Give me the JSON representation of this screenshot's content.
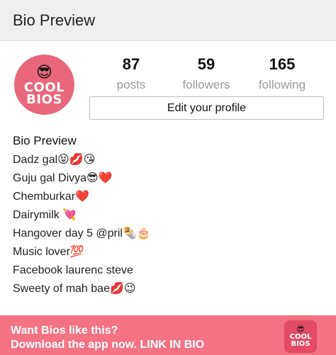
{
  "header": {
    "title": "Bio Preview"
  },
  "profile": {
    "avatar": {
      "emoji": "😎",
      "brand_line1": "COOL",
      "brand_line2": "BIOS"
    },
    "stats": [
      {
        "value": "87",
        "label": "posts"
      },
      {
        "value": "59",
        "label": "followers"
      },
      {
        "value": "165",
        "label": "following"
      }
    ],
    "edit_button": "Edit your profile"
  },
  "bio": {
    "name": "Bio Preview",
    "lines": [
      "Dadz gal😝💋😘",
      "Guju gal Divya😎❤️",
      "Chemburkar❤️",
      "Dairymilk 💘",
      "Hangover day 5 @pril🌯🎂",
      "Music lover💯",
      "Facebook laurenc steve",
      "Sweety of mah bae💋😉"
    ]
  },
  "banner": {
    "line1": "Want Bios like this?",
    "line2": "Download the app now. LINK IN BIO",
    "logo": {
      "emoji": "😎",
      "brand_line1": "COOL",
      "brand_line2": "BIOS"
    }
  },
  "colors": {
    "avatar_bg": "#e8677a",
    "banner_bg": "#f37382",
    "logo_bg": "#e14b63"
  }
}
